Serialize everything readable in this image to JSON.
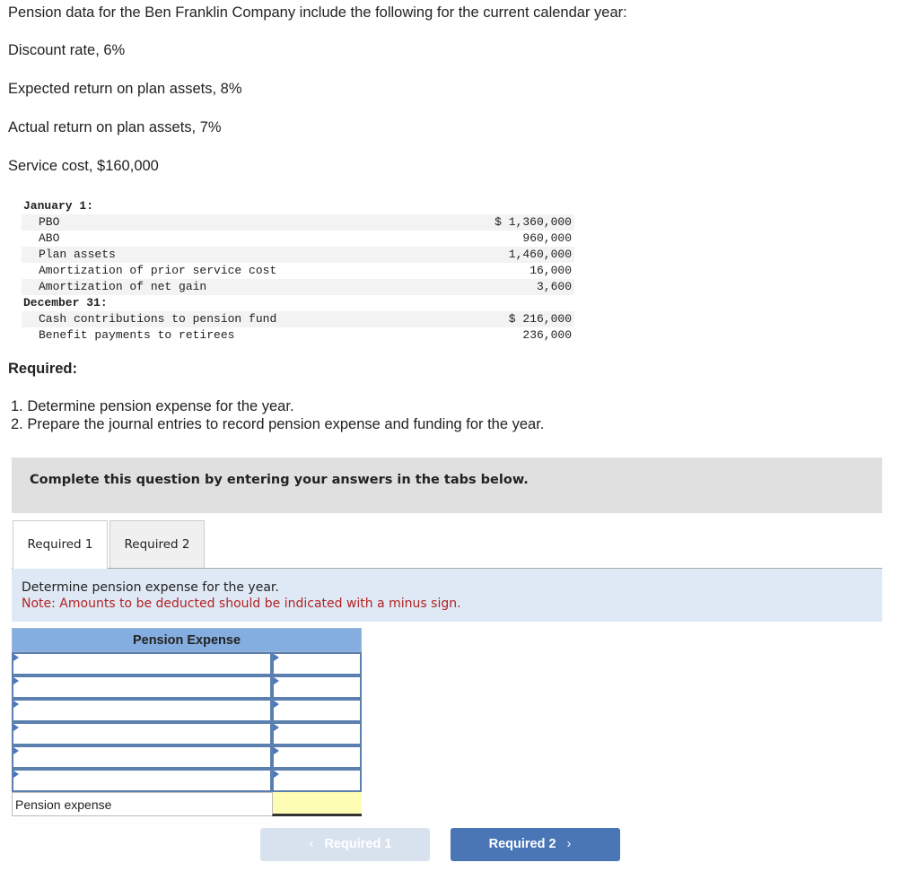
{
  "intro": {
    "heading": "Pension data for the Ben Franklin Company include the following for the current calendar year:",
    "facts": [
      "Discount rate, 6%",
      "Expected return on plan assets, 8%",
      "Actual return on plan assets, 7%",
      "Service cost, $160,000"
    ]
  },
  "data_table": {
    "jan_header": "January 1:",
    "jan_rows": [
      {
        "label": "PBO",
        "value": "$ 1,360,000"
      },
      {
        "label": "ABO",
        "value": "960,000"
      },
      {
        "label": "Plan assets",
        "value": "1,460,000"
      },
      {
        "label": "Amortization of prior service cost",
        "value": "16,000"
      },
      {
        "label": "Amortization of net gain",
        "value": "3,600"
      }
    ],
    "dec_header": "December 31:",
    "dec_rows": [
      {
        "label": "Cash contributions to pension fund",
        "value": "$ 216,000"
      },
      {
        "label": "Benefit payments to retirees",
        "value": "236,000"
      }
    ]
  },
  "required": {
    "heading": "Required:",
    "items": [
      "1. Determine pension expense for the year.",
      "2. Prepare the journal entries to record pension expense and funding for the year."
    ]
  },
  "banner": "Complete this question by entering your answers in the tabs below.",
  "tabs": [
    {
      "label": "Required 1",
      "active": true
    },
    {
      "label": "Required 2",
      "active": false
    }
  ],
  "instructions": {
    "line1": "Determine pension expense for the year.",
    "note": "Note: Amounts to be deducted should be indicated with a minus sign."
  },
  "pension_table": {
    "header": "Pension Expense",
    "rows": [
      {
        "description": "",
        "amount": ""
      },
      {
        "description": "",
        "amount": ""
      },
      {
        "description": "",
        "amount": ""
      },
      {
        "description": "",
        "amount": ""
      },
      {
        "description": "",
        "amount": ""
      },
      {
        "description": "",
        "amount": ""
      }
    ],
    "total_label": "Pension expense",
    "total_value": ""
  },
  "nav": {
    "prev_label": "Required 1",
    "next_label": "Required 2",
    "prev_icon": "‹",
    "next_icon": "›"
  }
}
